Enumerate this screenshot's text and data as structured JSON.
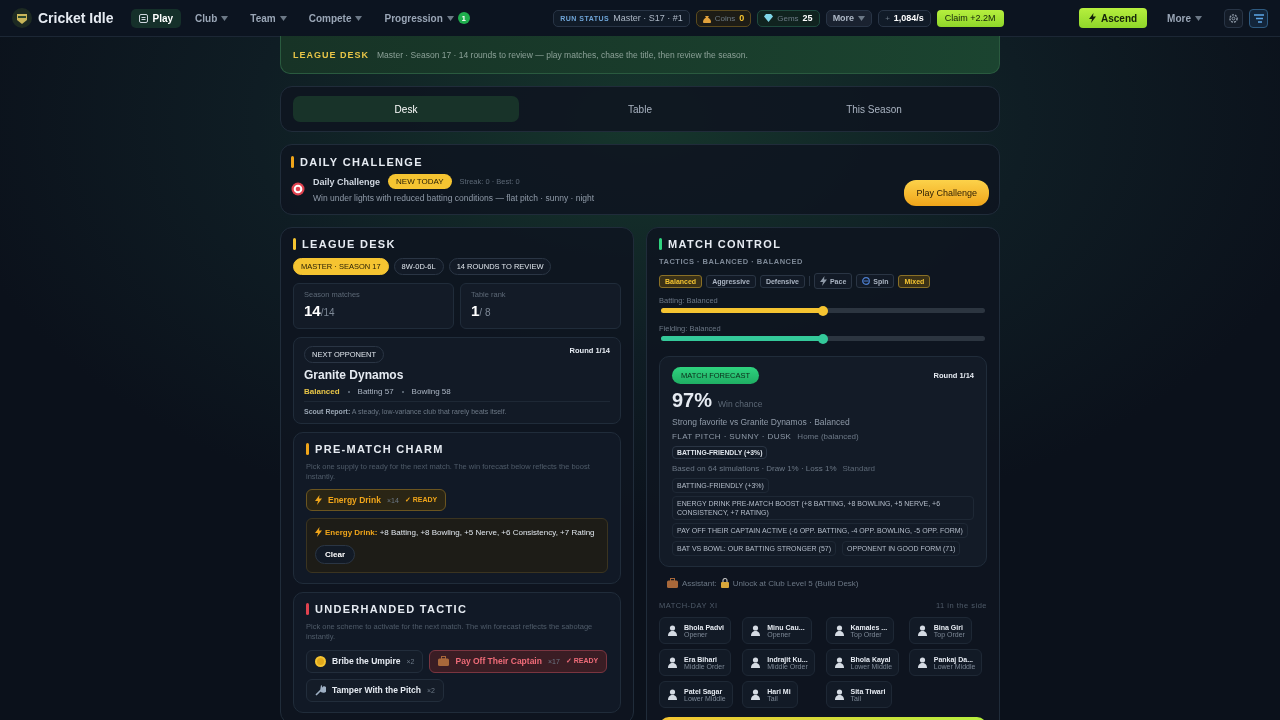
{
  "app": {
    "title": "Cricket Idle"
  },
  "nav": [
    {
      "label": "Play",
      "selected": true,
      "menu": false
    },
    {
      "label": "Club",
      "selected": false,
      "menu": true
    },
    {
      "label": "Team",
      "selected": false,
      "menu": true
    },
    {
      "label": "Compete",
      "selected": false,
      "menu": true
    },
    {
      "label": "Progression",
      "selected": false,
      "menu": true,
      "badge": "1"
    }
  ],
  "status": {
    "label": "RUN STATUS",
    "value": "Master · S17 · #1"
  },
  "currencies": [
    {
      "kind": "coins",
      "label": "Coins",
      "value": "0"
    },
    {
      "kind": "gems",
      "label": "Gems",
      "value": "25"
    }
  ],
  "more_menu": "More",
  "rate": {
    "prefix": "+",
    "value": "1,084/s"
  },
  "claim_button": "Claim +2.2M",
  "ascend_button": "Ascend",
  "more_button": "More",
  "banner": {
    "label": "LEAGUE DESK",
    "text": "Master · Season 17 · 14 rounds to review — play matches, chase the title, then review the season."
  },
  "tabs": [
    {
      "label": "Desk",
      "selected": true
    },
    {
      "label": "Table",
      "selected": false
    },
    {
      "label": "This Season",
      "selected": false
    }
  ],
  "daily": {
    "heading": "DAILY CHALLENGE",
    "title": "Daily Challenge",
    "badge": "NEW TODAY",
    "streak": "Streak: 0 · Best: 0",
    "description": "Win under lights with reduced batting conditions — flat pitch · sunny · night",
    "button": "Play Challenge"
  },
  "league": {
    "heading": "LEAGUE DESK",
    "chips": [
      {
        "label": "MASTER · SEASON 17",
        "highlight": true
      },
      {
        "label": "8W-0D-6L",
        "highlight": false
      },
      {
        "label": "14 ROUNDS TO REVIEW",
        "highlight": false
      }
    ],
    "stats": [
      {
        "label": "Season matches",
        "value": "14",
        "suffix": "/14"
      },
      {
        "label": "Table rank",
        "value": "1",
        "suffix": "/ 8"
      }
    ],
    "opponent": {
      "badge": "NEXT OPPONENT",
      "round": "Round 1/14",
      "name": "Granite Dynamos",
      "style": "Balanced",
      "meta": [
        "Batting 57",
        "Bowling 58"
      ],
      "scout": "**Scout Report:** A steady, low-variance club that rarely beats itself."
    }
  },
  "charm": {
    "heading": "PRE-MATCH CHARM",
    "description": "Pick one supply to ready for the next match. The win forecast below reflects the boost instantly.",
    "items": [
      {
        "kind": "bolt",
        "name": "Energy Drink",
        "count": "×14",
        "ready": "✓ READY",
        "selected": true
      }
    ],
    "detail": "**Energy Drink:** +8 Batting, +8 Bowling, +5 Nerve, +6 Consistency, +7 Rating",
    "clear_button": "Clear"
  },
  "tactic": {
    "heading": "UNDERHANDED TACTIC",
    "description": "Pick one scheme to activate for the next match. The win forecast reflects the sabotage instantly.",
    "items": [
      {
        "kind": "coin",
        "name": "Bribe the Umpire",
        "count": "×2",
        "selected": false
      },
      {
        "kind": "briefcase",
        "name": "Pay Off Their Captain",
        "count": "×17",
        "ready": "✓ READY",
        "selected": true
      },
      {
        "kind": "wrench",
        "name": "Tamper With the Pitch",
        "count": "×2",
        "selected": false
      }
    ]
  },
  "match": {
    "heading": "MATCH CONTROL",
    "tactics_label": "TACTICS · BALANCED · BALANCED",
    "approach": [
      {
        "label": "Balanced",
        "selected": true
      },
      {
        "label": "Aggressive",
        "selected": false
      },
      {
        "label": "Defensive",
        "selected": false
      }
    ],
    "bowling": [
      {
        "kind": "pace",
        "label": "Pace",
        "selected": false
      },
      {
        "kind": "spin",
        "label": "Spin",
        "selected": false
      },
      {
        "kind": "none",
        "label": "Mixed",
        "selected": true
      }
    ],
    "sliders": [
      {
        "label": "Batting: Balanced",
        "level": 0.5,
        "color": "#f5c431"
      },
      {
        "label": "Fielding: Balanced",
        "level": 0.5,
        "color": "#34c99a"
      }
    ],
    "forecast": {
      "badge": "MATCH FORECAST",
      "round": "Round 1/14",
      "percent": "97%",
      "caption": "Win chance",
      "summary": "Strong favorite vs Granite Dynamos · Balanced",
      "conditions": "FLAT PITCH · SUNNY · DUSK",
      "venue": "Home (balanced)",
      "pitch_tag": "BATTING-FRIENDLY (+3%)",
      "simulations": "Based on 64 simulations · Draw 1% · Loss 1%",
      "mode": "Standard",
      "factors": [
        "BATTING-FRIENDLY (+3%)",
        "ENERGY DRINK PRE-MATCH BOOST (+8 BATTING, +8 BOWLING, +5 NERVE, +6 CONSISTENCY, +7 RATING)",
        "PAY OFF THEIR CAPTAIN ACTIVE (-6 OPP. BATTING, -4 OPP. BOWLING, -5 OPP. FORM)",
        "BAT VS BOWL: OUR BATTING STRONGER (57)",
        "OPPONENT IN GOOD FORM (71)"
      ]
    },
    "assistant": {
      "label": "Assistant:",
      "text": "Unlock at Club Level 5 (Build Desk)"
    },
    "xi_label": "MATCH-DAY XI",
    "xi_count": "11 in the side",
    "players": [
      {
        "name": "Bhola Padvi",
        "role": "Opener"
      },
      {
        "name": "Minu Cau...",
        "role": "Opener"
      },
      {
        "name": "Kamales ...",
        "role": "Top Order"
      },
      {
        "name": "Bina Giri",
        "role": "Top Order"
      },
      {
        "name": "Era Bihari",
        "role": "Middle Order"
      },
      {
        "name": "Indrajit Ku...",
        "role": "Middle Order"
      },
      {
        "name": "Bhola Kayal",
        "role": "Lower Middle"
      },
      {
        "name": "Pankaj Da...",
        "role": "Lower Middle"
      },
      {
        "name": "Patel Sagar",
        "role": "Lower Middle"
      },
      {
        "name": "Hari Mi",
        "role": "Tail"
      },
      {
        "name": "Sita Tiwari",
        "role": "Tail"
      }
    ]
  }
}
